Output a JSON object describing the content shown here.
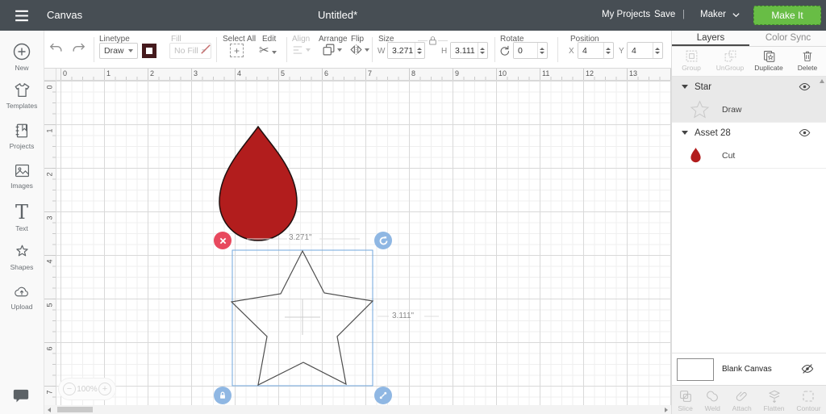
{
  "colors": {
    "header_bg": "#474e54",
    "accent_green": "#68bd45",
    "shape_red": "#b21d1d",
    "selection_blue": "#72a7dc",
    "handle_red": "#e8495e",
    "handle_blue": "#8fb7e3",
    "linetype_swatch": "#451a1d"
  },
  "header": {
    "app_title": "Canvas",
    "doc_title": "Untitled*",
    "my_projects": "My Projects",
    "save": "Save",
    "divider": "|",
    "machine": "Maker",
    "make_it": "Make It"
  },
  "toolbar": {
    "linetype_label": "Linetype",
    "linetype_value": "Draw",
    "fill_label": "Fill",
    "fill_value": "No Fill",
    "select_all_label": "Select All",
    "edit_label": "Edit",
    "align_label": "Align",
    "arrange_label": "Arrange",
    "flip_label": "Flip",
    "size_label": "Size",
    "w_label": "W",
    "w_value": "3.271",
    "h_label": "H",
    "h_value": "3.111",
    "rotate_label": "Rotate",
    "rotate_value": "0",
    "position_label": "Position",
    "x_label": "X",
    "x_value": "4",
    "y_label": "Y",
    "y_value": "4"
  },
  "sidebar": {
    "items": [
      {
        "label": "New",
        "icon": "plus-circle-icon"
      },
      {
        "label": "Templates",
        "icon": "tshirt-icon"
      },
      {
        "label": "Projects",
        "icon": "notebook-icon"
      },
      {
        "label": "Images",
        "icon": "image-icon"
      },
      {
        "label": "Text",
        "icon": "text-icon"
      },
      {
        "label": "Shapes",
        "icon": "star-blob-icon"
      },
      {
        "label": "Upload",
        "icon": "cloud-upload-icon"
      }
    ],
    "feedback_icon": "chat-bubble-icon"
  },
  "canvas": {
    "h_ruler": [
      "0",
      "1",
      "2",
      "3",
      "4",
      "5",
      "6",
      "7",
      "8",
      "9",
      "10",
      "11",
      "12",
      "13"
    ],
    "v_ruler": [
      "0",
      "1",
      "2",
      "3",
      "4",
      "5",
      "6",
      "7"
    ],
    "zoom_minus": "−",
    "zoom_value": "100%",
    "zoom_plus": "+",
    "selection": {
      "width_label": "3.271\"",
      "height_label": "3.111\""
    }
  },
  "layers_panel": {
    "tabs": [
      {
        "label": "Layers",
        "active": true
      },
      {
        "label": "Color Sync",
        "active": false
      }
    ],
    "actions": [
      {
        "label": "Group",
        "icon": "group-icon",
        "enabled": false
      },
      {
        "label": "UnGroup",
        "icon": "ungroup-icon",
        "enabled": false
      },
      {
        "label": "Duplicate",
        "icon": "duplicate-icon",
        "enabled": true
      },
      {
        "label": "Delete",
        "icon": "trash-icon",
        "enabled": true
      }
    ],
    "groups": [
      {
        "name": "Star",
        "selected": true,
        "layers": [
          {
            "operation": "Draw",
            "thumb": "star-outline-thumb"
          }
        ]
      },
      {
        "name": "Asset 28",
        "selected": false,
        "layers": [
          {
            "operation": "Cut",
            "thumb": "red-drop-thumb"
          }
        ]
      }
    ],
    "blank_canvas_label": "Blank Canvas",
    "footer_tools": [
      {
        "label": "Slice",
        "icon": "slice-icon"
      },
      {
        "label": "Weld",
        "icon": "weld-icon"
      },
      {
        "label": "Attach",
        "icon": "attach-icon"
      },
      {
        "label": "Flatten",
        "icon": "flatten-icon"
      },
      {
        "label": "Contour",
        "icon": "contour-icon"
      }
    ]
  }
}
